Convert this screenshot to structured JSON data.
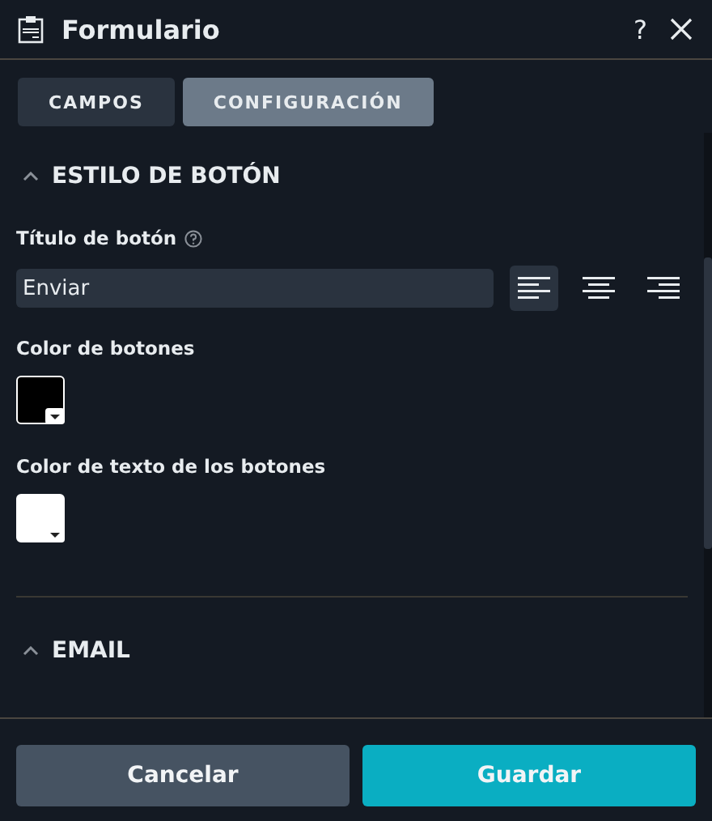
{
  "window": {
    "title": "Formulario",
    "help": "?"
  },
  "tabs": [
    {
      "label": "CAMPOS",
      "selected": false
    },
    {
      "label": "CONFIGURACIÓN",
      "selected": true
    }
  ],
  "sections": [
    {
      "title": "ESTILO DE BOTÓN",
      "expanded": true,
      "button_title": {
        "label": "Título de botón",
        "value": "Enviar",
        "alignments": [
          {
            "kind": "left",
            "selected": true
          },
          {
            "kind": "center",
            "selected": false
          },
          {
            "kind": "right",
            "selected": false
          }
        ]
      },
      "colors": [
        {
          "label": "Color de botones",
          "color": "#000000"
        },
        {
          "label": "Color de texto de los botones",
          "color": "#ffffff"
        }
      ]
    },
    {
      "title": "EMAIL",
      "expanded": true
    }
  ],
  "buttons": [
    {
      "label": "Cancelar",
      "kind": "secondary"
    },
    {
      "label": "Guardar",
      "kind": "primary"
    }
  ]
}
